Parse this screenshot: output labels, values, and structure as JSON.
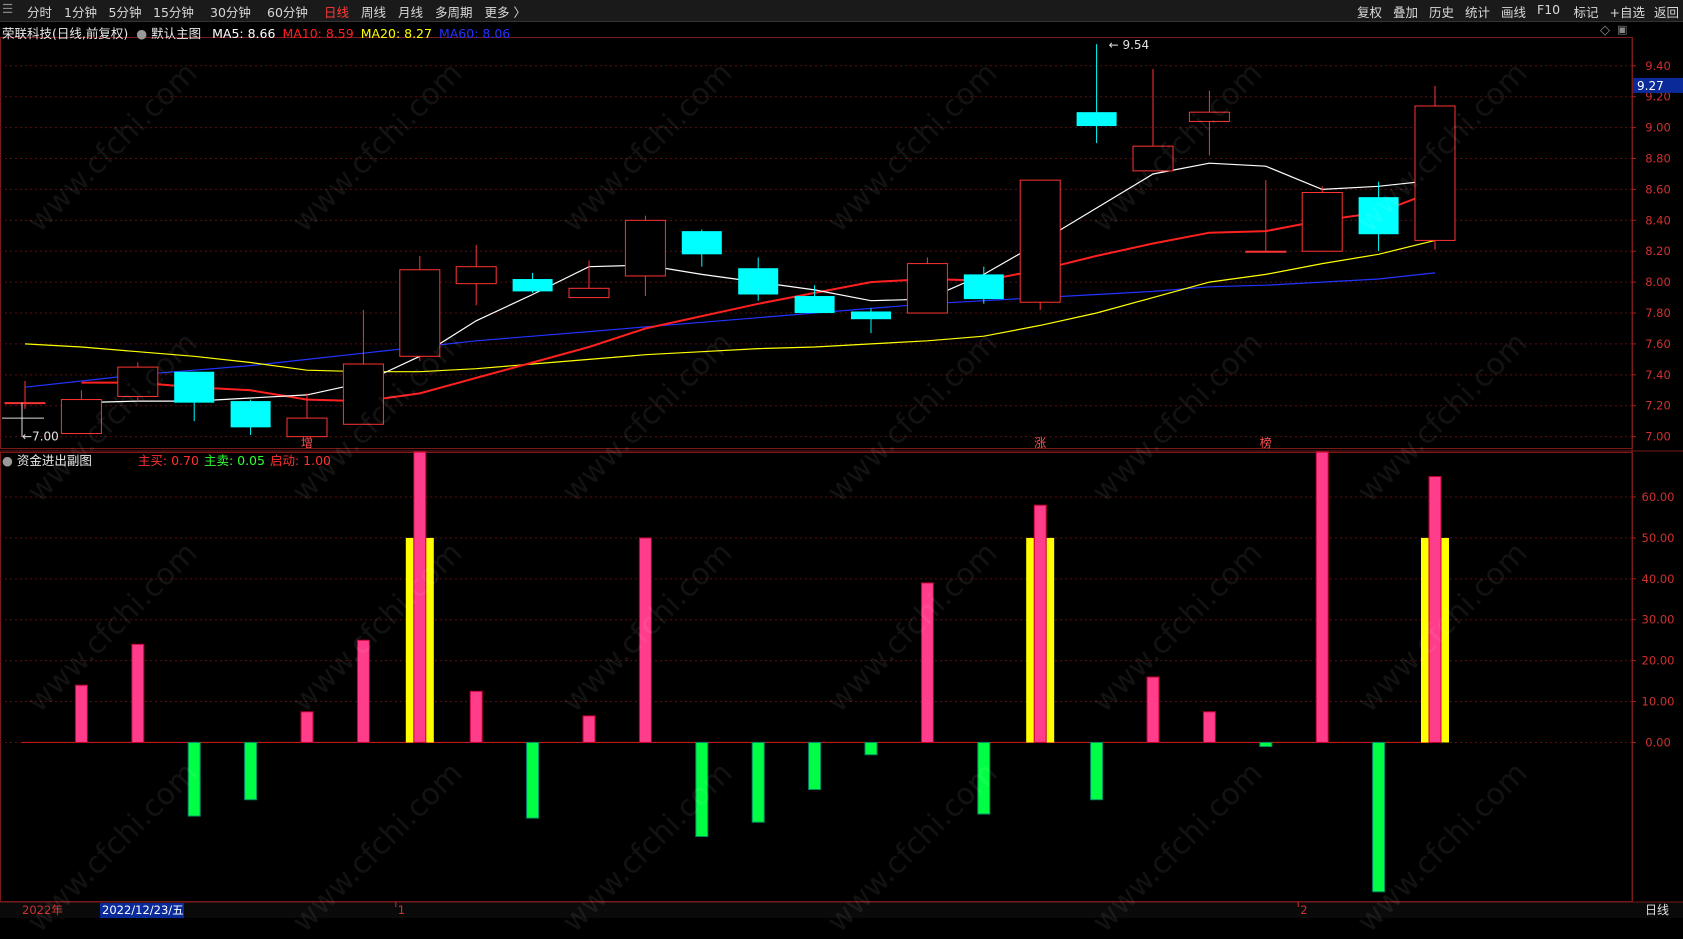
{
  "toolbar": {
    "left_items": [
      {
        "label": "分时",
        "active": false
      },
      {
        "label": "1分钟",
        "active": false
      },
      {
        "label": "5分钟",
        "active": false
      },
      {
        "label": "15分钟",
        "active": false
      },
      {
        "label": "30分钟",
        "active": false
      },
      {
        "label": "60分钟",
        "active": false
      },
      {
        "label": "日线",
        "active": true
      },
      {
        "label": "周线",
        "active": false
      },
      {
        "label": "月线",
        "active": false
      },
      {
        "label": "多周期",
        "active": false
      },
      {
        "label": "更多 〉",
        "active": false
      }
    ],
    "right_items": [
      "复权",
      "叠加",
      "历史",
      "统计",
      "画线",
      "F10",
      "标记",
      "+自选",
      "返回"
    ]
  },
  "main_chart": {
    "title": "荣联科技(日线,前复权)",
    "indicator_name": "默认主图",
    "ma": [
      {
        "label": "MA5: 8.66",
        "color": "#ffffff"
      },
      {
        "label": "MA10: 8.59",
        "color": "#ff2020"
      },
      {
        "label": "MA20: 8.27",
        "color": "#ffff00"
      },
      {
        "label": "MA60: 8.06",
        "color": "#2233ff"
      }
    ],
    "price_axis_ticks": [
      "9.40",
      "9.20",
      "9.00",
      "8.80",
      "8.60",
      "8.40",
      "8.20",
      "8.00",
      "7.80",
      "7.60",
      "7.40",
      "7.20",
      "7.00"
    ],
    "current_price": "9.27",
    "high_marker": "9.54",
    "low_marker": "7.00",
    "event_markers": [
      {
        "label": "增",
        "bar_index": 5
      },
      {
        "label": "涨",
        "bar_index": 18
      },
      {
        "label": "榜",
        "bar_index": 22
      }
    ]
  },
  "sub_chart": {
    "title": "资金进出副图",
    "params": [
      {
        "label": "主买: 0.70",
        "color": "#ff3030"
      },
      {
        "label": "主卖: 0.05",
        "color": "#30ff30"
      },
      {
        "label": "启动: 1.00",
        "color": "#ff3030"
      }
    ],
    "axis_ticks": [
      "60.00",
      "50.00",
      "40.00",
      "30.00",
      "20.00",
      "10.00",
      "0.00"
    ]
  },
  "time_axis": {
    "year": "2022年",
    "cursor_date": "2022/12/23/五",
    "month_marks": [
      {
        "label": "1",
        "bar_index": 7
      },
      {
        "label": "2",
        "bar_index": 23
      }
    ]
  },
  "period_label": "日线",
  "watermark": "www.cfchi.com",
  "colors": {
    "up": "#ff3333",
    "down": "#00ffff",
    "ma5": "#ffffff",
    "ma10": "#ff2020",
    "ma20": "#ffff00",
    "ma60": "#2233ff",
    "buy_bar": "#ff3d8b",
    "sell_bar": "#00ff44",
    "start_bar": "#ffff00"
  },
  "chart_data": {
    "type": "candlestick",
    "candles": [
      {
        "o": 7.22,
        "h": 7.36,
        "l": 7.18,
        "c": 7.22
      },
      {
        "o": 7.02,
        "h": 7.3,
        "l": 7.02,
        "c": 7.24
      },
      {
        "o": 7.26,
        "h": 7.48,
        "l": 7.23,
        "c": 7.45
      },
      {
        "o": 7.42,
        "h": 7.42,
        "l": 7.1,
        "c": 7.22
      },
      {
        "o": 7.23,
        "h": 7.24,
        "l": 7.01,
        "c": 7.06
      },
      {
        "o": 7.0,
        "h": 7.28,
        "l": 7.0,
        "c": 7.12
      },
      {
        "o": 7.08,
        "h": 7.82,
        "l": 7.08,
        "c": 7.47
      },
      {
        "o": 7.52,
        "h": 8.17,
        "l": 7.49,
        "c": 8.08
      },
      {
        "o": 7.99,
        "h": 8.24,
        "l": 7.85,
        "c": 8.1
      },
      {
        "o": 8.02,
        "h": 8.06,
        "l": 7.93,
        "c": 7.94
      },
      {
        "o": 7.9,
        "h": 8.14,
        "l": 7.9,
        "c": 7.96
      },
      {
        "o": 8.04,
        "h": 8.43,
        "l": 7.91,
        "c": 8.4
      },
      {
        "o": 8.33,
        "h": 8.34,
        "l": 8.1,
        "c": 8.18
      },
      {
        "o": 8.09,
        "h": 8.16,
        "l": 7.88,
        "c": 7.92
      },
      {
        "o": 7.91,
        "h": 7.98,
        "l": 7.8,
        "c": 7.8
      },
      {
        "o": 7.81,
        "h": 7.83,
        "l": 7.67,
        "c": 7.76
      },
      {
        "o": 7.8,
        "h": 8.16,
        "l": 7.8,
        "c": 8.12
      },
      {
        "o": 8.05,
        "h": 8.1,
        "l": 7.86,
        "c": 7.89
      },
      {
        "o": 7.87,
        "h": 8.66,
        "l": 7.82,
        "c": 8.66
      },
      {
        "o": 9.1,
        "h": 9.54,
        "l": 8.9,
        "c": 9.01
      },
      {
        "o": 8.72,
        "h": 9.38,
        "l": 8.72,
        "c": 8.88
      },
      {
        "o": 9.04,
        "h": 9.24,
        "l": 8.82,
        "c": 9.1
      },
      {
        "o": 8.2,
        "h": 8.66,
        "l": 8.2,
        "c": 8.2
      },
      {
        "o": 8.2,
        "h": 8.62,
        "l": 8.2,
        "c": 8.58
      },
      {
        "o": 8.55,
        "h": 8.65,
        "l": 8.2,
        "c": 8.31
      },
      {
        "o": 8.27,
        "h": 9.27,
        "l": 8.21,
        "c": 9.14
      }
    ],
    "ma5": [
      7.22,
      7.23,
      7.23,
      7.25,
      7.27,
      7.35,
      7.52,
      7.75,
      7.92,
      8.1,
      8.11,
      8.05,
      8.0,
      7.95,
      7.88,
      7.89,
      8.05,
      8.26,
      8.48,
      8.7,
      8.77,
      8.75,
      8.6,
      8.62,
      8.66
    ],
    "ma10": [
      7.35,
      7.35,
      7.32,
      7.3,
      7.24,
      7.23,
      7.28,
      7.38,
      7.48,
      7.58,
      7.7,
      7.78,
      7.86,
      7.93,
      8.0,
      8.02,
      8.01,
      8.08,
      8.17,
      8.25,
      8.32,
      8.33,
      8.4,
      8.45,
      8.59
    ],
    "ma20": [
      7.6,
      7.58,
      7.55,
      7.52,
      7.48,
      7.43,
      7.42,
      7.42,
      7.44,
      7.47,
      7.5,
      7.53,
      7.55,
      7.57,
      7.58,
      7.6,
      7.62,
      7.65,
      7.72,
      7.8,
      7.9,
      8.0,
      8.05,
      8.12,
      8.18,
      8.27
    ],
    "ma60": [
      7.32,
      7.36,
      7.4,
      7.43,
      7.46,
      7.5,
      7.54,
      7.58,
      7.62,
      7.65,
      7.68,
      7.71,
      7.74,
      7.77,
      7.8,
      7.83,
      7.86,
      7.88,
      7.9,
      7.92,
      7.94,
      7.97,
      7.98,
      8.0,
      8.02,
      8.06
    ],
    "fund_flow": [
      {
        "v": 0
      },
      {
        "v": 14
      },
      {
        "v": 24
      },
      {
        "v": -18
      },
      {
        "v": -14
      },
      {
        "v": 7.5
      },
      {
        "v": 25
      },
      {
        "v": 71,
        "start": 50
      },
      {
        "v": 12.5
      },
      {
        "v": -18.5
      },
      {
        "v": 6.5
      },
      {
        "v": 50
      },
      {
        "v": -23
      },
      {
        "v": -19.5
      },
      {
        "v": -11.5
      },
      {
        "v": -3
      },
      {
        "v": 39
      },
      {
        "v": -17.5
      },
      {
        "v": 58,
        "start": 50
      },
      {
        "v": -14
      },
      {
        "v": 16
      },
      {
        "v": 7.5
      },
      {
        "v": -1
      },
      {
        "v": 71
      },
      {
        "v": -36.5
      },
      {
        "v": 65,
        "start": 50
      }
    ],
    "price_ylim": [
      6.92,
      9.58
    ],
    "sub_ylim": [
      -39,
      71
    ]
  }
}
